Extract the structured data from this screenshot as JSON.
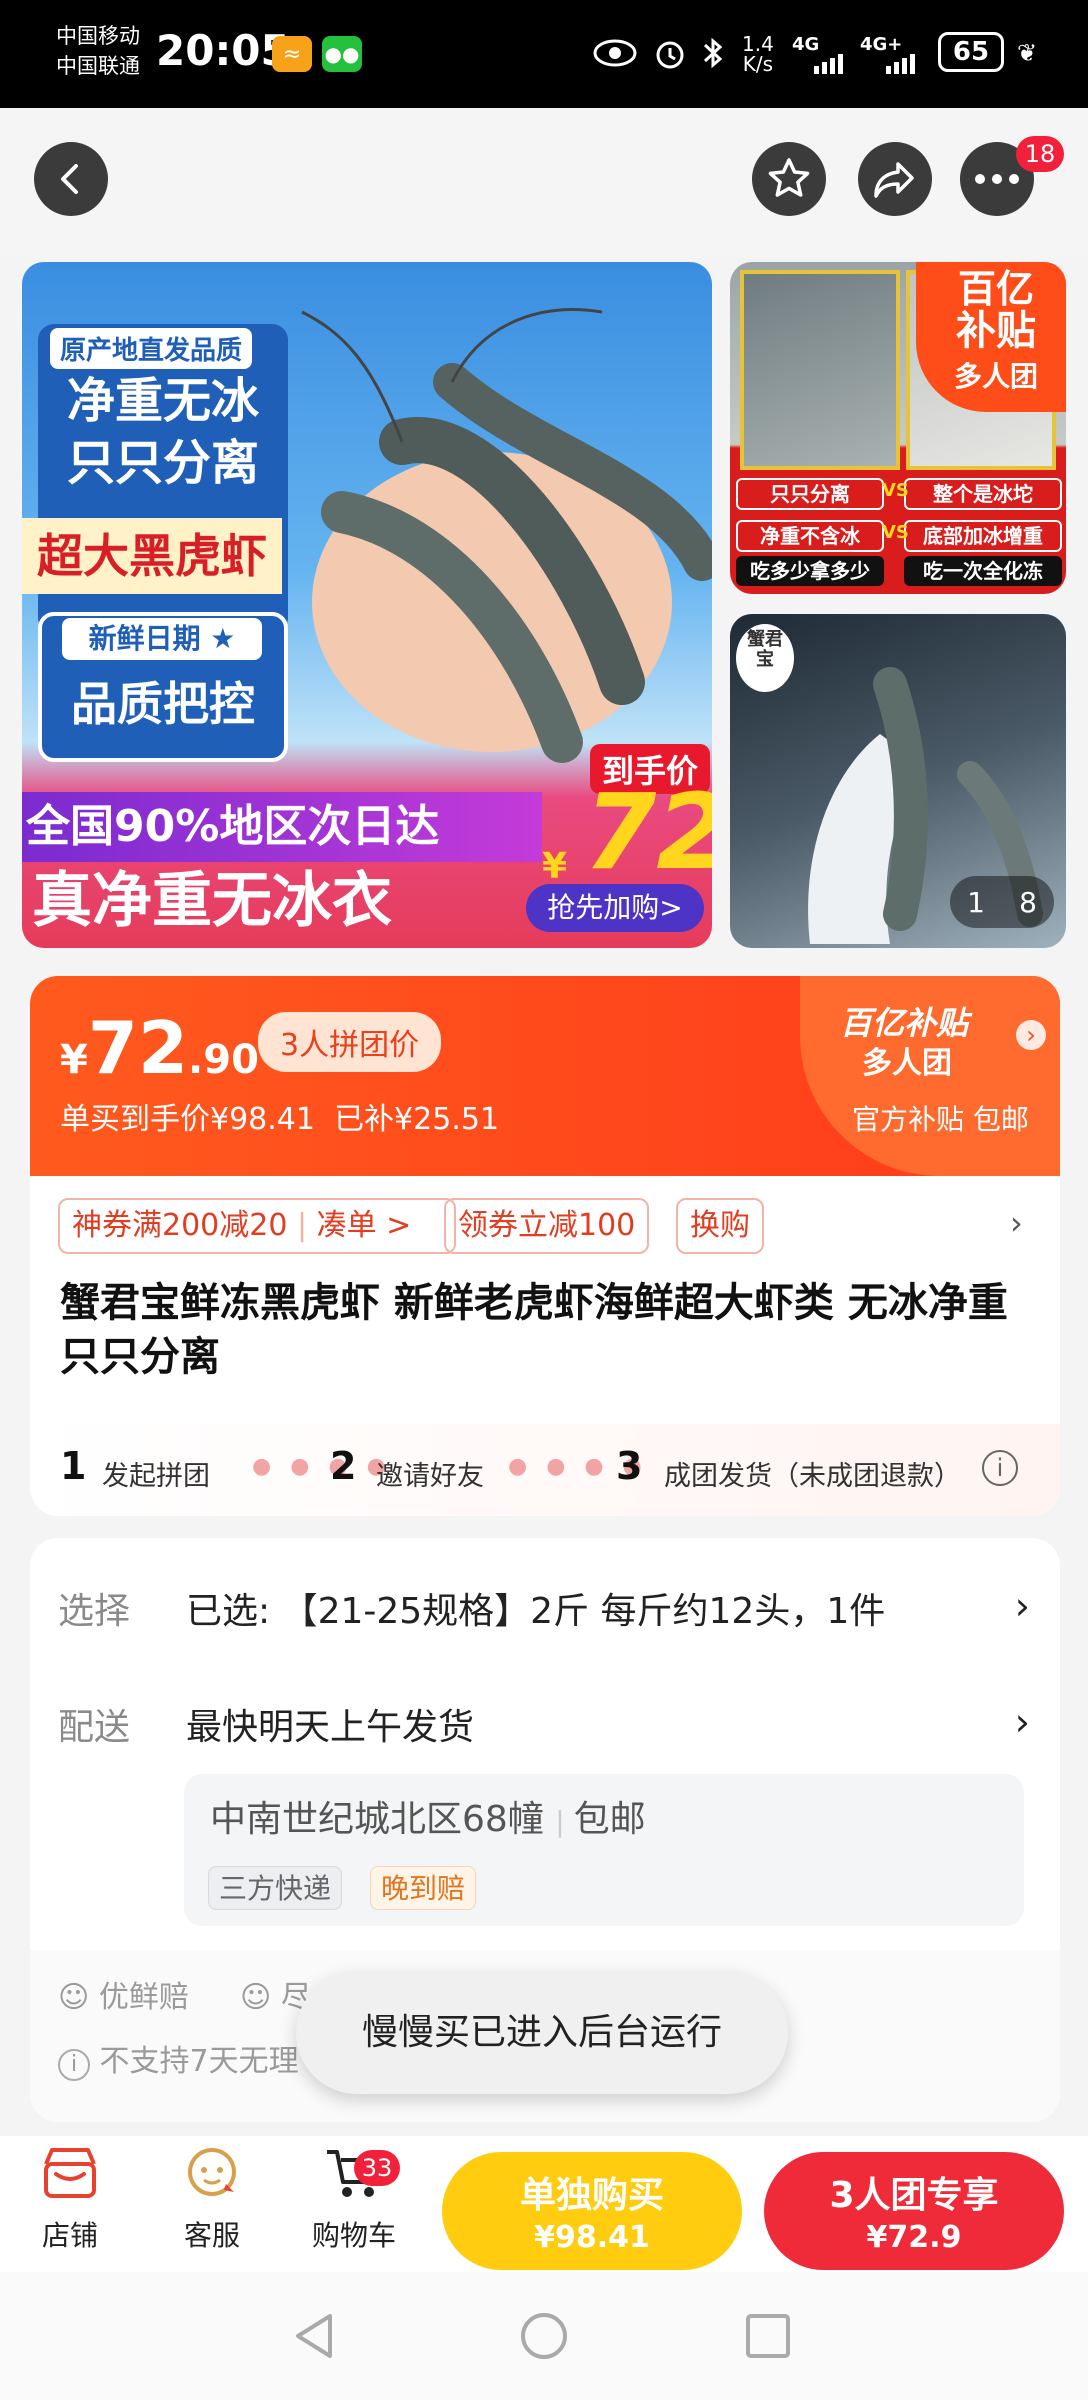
{
  "status_bar": {
    "carrier1": "中国移动",
    "carrier2": "中国联通",
    "time": "20:05",
    "net_speed": "1.4\nK/s",
    "net1": "4G",
    "net2": "4G+",
    "battery": "65"
  },
  "top_nav": {
    "badge_count": "18"
  },
  "gallery": {
    "main": {
      "tag_origin": "原产地直发品质",
      "line1": "净重无冰",
      "line2": "只只分离",
      "banner": "超大黑虎虾",
      "fresh_date": "新鲜日期 ★",
      "quality": "品质把控",
      "delivery": "全国90%地区次日达",
      "no_ice": "真净重无冰衣",
      "price_label": "到手价",
      "currency": "¥",
      "price": "72",
      "cta": "抢先加购>"
    },
    "thumb1": {
      "badge_line1": "百亿",
      "badge_line2": "补贴",
      "badge_line3": "多人团",
      "c1": "只只分离",
      "c2": "整个是冰坨",
      "c3": "净重不含冰",
      "c4": "底部加冰增重",
      "c5": "吃多少拿多少",
      "c6": "吃一次全化冻",
      "vs": "VS"
    },
    "thumb2": {
      "brand": "蟹君宝",
      "page_index": "1",
      "page_total": "8"
    }
  },
  "price_card": {
    "currency": "¥",
    "price_int": "72",
    "price_dec": ".90",
    "group_label": "3人拼团价",
    "single_price": "单买到手价¥98.41",
    "subsidy": "已补¥25.51",
    "brand_line1": "百亿补贴",
    "brand_line2": "多人团",
    "official": "官方补贴 包邮",
    "coupons": [
      "神券满200减20",
      "凑单 >",
      "领券立减100",
      "换购"
    ],
    "title": "蟹君宝鲜冻黑虎虾 新鲜老虎虾海鲜超大虾类 无冰净重 只只分离",
    "steps": [
      {
        "num": "1",
        "label": "发起拼团"
      },
      {
        "num": "2",
        "label": "邀请好友"
      },
      {
        "num": "3",
        "label": "成团发货（未成团退款）"
      }
    ]
  },
  "spec_card": {
    "select_label": "选择",
    "select_value": "已选: 【21-25规格】2斤  每斤约12头，1件",
    "delivery_label": "配送",
    "delivery_value": "最快明天上午发货",
    "address": "中南世纪城北区68幢",
    "shipping": "包邮",
    "chip1": "三方快递",
    "chip2": "晚到赔",
    "assure1": "优鲜赔",
    "assure2": "尽",
    "no_return": "不支持7天无理"
  },
  "toast": "慢慢买已进入后台运行",
  "bottom_bar": {
    "store": "店铺",
    "service": "客服",
    "cart": "购物车",
    "cart_count": "33",
    "buy_single_l1": "单独购买",
    "buy_single_l2": "¥98.41",
    "buy_group_l1": "3人团专享",
    "buy_group_l2": "¥72.9"
  },
  "colors": {
    "accent": "#ff4a1c",
    "yellow": "#ffcc10",
    "red_button": "#ef2b3a"
  }
}
